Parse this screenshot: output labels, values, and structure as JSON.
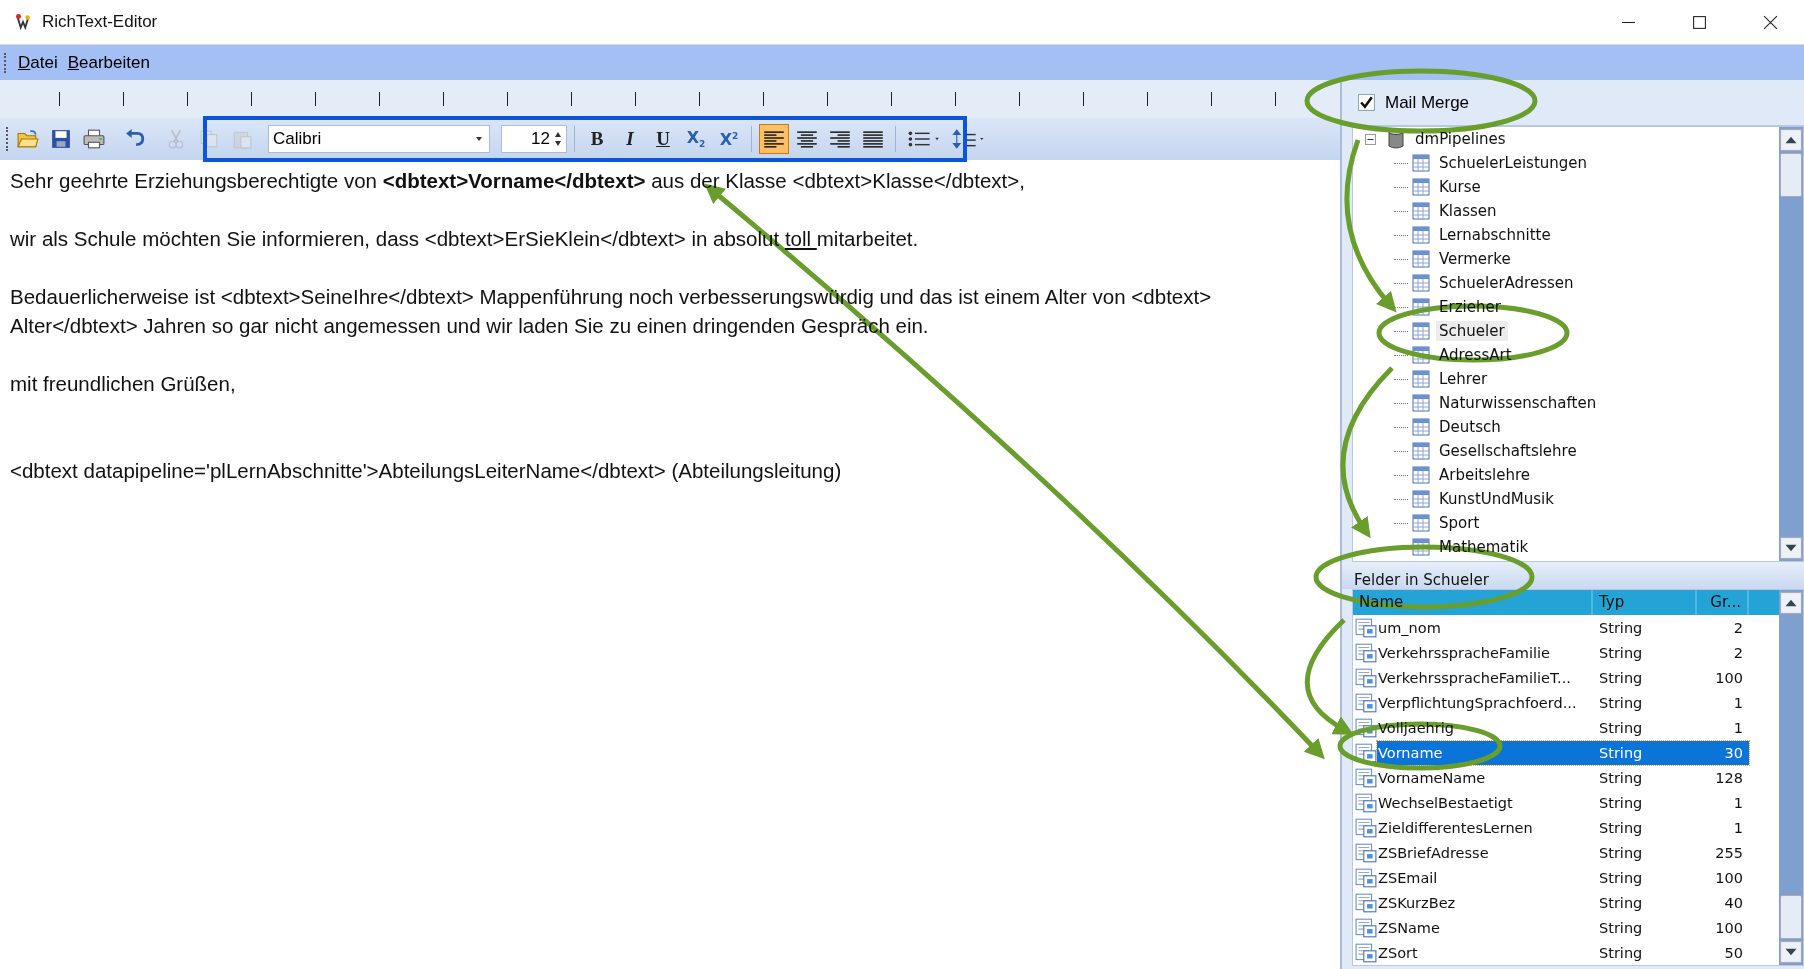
{
  "window": {
    "title": "RichText-Editor"
  },
  "menu": [
    {
      "label": "Datei"
    },
    {
      "label": "Bearbeiten"
    }
  ],
  "toolbar": {
    "file_buttons": [
      {
        "kind": "open",
        "disabled": false
      },
      {
        "kind": "save",
        "disabled": false
      },
      {
        "kind": "print",
        "disabled": false
      },
      {
        "kind": "undo",
        "disabled": false
      },
      {
        "kind": "cut",
        "disabled": true
      },
      {
        "kind": "copy",
        "disabled": true
      },
      {
        "kind": "paste",
        "disabled": true
      }
    ],
    "font_family": "Calibri",
    "font_size": "12",
    "format_buttons": [
      {
        "kind": "bold",
        "label": "B"
      },
      {
        "kind": "italic",
        "label": "I"
      },
      {
        "kind": "underline",
        "label": "U"
      },
      {
        "kind": "subscript",
        "label": "X$_{2}$"
      },
      {
        "kind": "superscript",
        "label": "X$^{2}$"
      }
    ],
    "align_buttons": [
      {
        "kind": "left",
        "selected": true
      },
      {
        "kind": "center",
        "selected": false
      },
      {
        "kind": "right",
        "selected": false
      },
      {
        "kind": "justify",
        "selected": false
      }
    ],
    "list_buttons": [
      {
        "kind": "bullets"
      },
      {
        "kind": "spacing"
      }
    ]
  },
  "document": {
    "paragraphs": [
      {
        "runs": [
          {
            "text": "Sehr geehrte Erziehungsberechtigte von **<dbtext>Vorname</dbtext>** aus der Klasse <dbtext>Klasse</dbtext>,",
            "underline": false
          }
        ]
      },
      {
        "runs": [
          {
            "text": "wir als Schule möchten Sie informieren, dass <dbtext>ErSieKlein</dbtext> in absolut ",
            "underline": false
          },
          {
            "text": "toll ",
            "underline": true
          },
          {
            "text": "mitarbeitet.",
            "underline": false
          }
        ]
      },
      {
        "runs": [
          {
            "text": "Bedauerlicherweise ist <dbtext>SeineIhre</dbtext> Mappenführung noch verbesserungswürdig und das ist einem Alter von <dbtext> Alter</dbtext> Jahren so gar nicht angemessen und wir laden Sie zu einen dringenden Gespräch ein.",
            "underline": false
          }
        ]
      },
      {
        "runs": [
          {
            "text": "mit freundlichen Grüßen,",
            "underline": false
          }
        ]
      },
      {
        "runs": [
          {
            "text": "<dbtext datapipeline='plLernAbschnitte'>AbteilungsLeiterName</dbtext> (Abteilungsleitung)",
            "underline": false
          }
        ]
      }
    ]
  },
  "mail_merge": {
    "label": "Mail Merge",
    "checked": true
  },
  "tree": {
    "label": "dmPipelines",
    "expanded": true,
    "children": [
      {
        "label": "SchuelerLeistungen",
        "selected": false
      },
      {
        "label": "Kurse",
        "selected": false
      },
      {
        "label": "Klassen",
        "selected": false
      },
      {
        "label": "Lernabschnitte",
        "selected": false
      },
      {
        "label": "Vermerke",
        "selected": false
      },
      {
        "label": "SchuelerAdressen",
        "selected": false
      },
      {
        "label": "Erzieher",
        "selected": false
      },
      {
        "label": "Schueler",
        "selected": true
      },
      {
        "label": "AdressArt",
        "selected": false
      },
      {
        "label": "Lehrer",
        "selected": false
      },
      {
        "label": "Naturwissenschaften",
        "selected": false
      },
      {
        "label": "Deutsch",
        "selected": false
      },
      {
        "label": "Gesellschaftslehre",
        "selected": false
      },
      {
        "label": "Arbeitslehre",
        "selected": false
      },
      {
        "label": "KunstUndMusik",
        "selected": false
      },
      {
        "label": "Sport",
        "selected": false
      },
      {
        "label": "Mathematik",
        "selected": false
      }
    ]
  },
  "fields": {
    "title": "Felder in Schueler",
    "columns": [
      "Name",
      "Typ",
      "Gr..."
    ],
    "rows": [
      {
        "name": "um_nom",
        "type": "String",
        "size": "2",
        "selected": false
      },
      {
        "name": "VerkehrsspracheFamilie",
        "type": "String",
        "size": "2",
        "selected": false
      },
      {
        "name": "VerkehrsspracheFamilieT...",
        "type": "String",
        "size": "100",
        "selected": false
      },
      {
        "name": "VerpflichtungSprachfoerd...",
        "type": "String",
        "size": "1",
        "selected": false
      },
      {
        "name": "Volljaehrig",
        "type": "String",
        "size": "1",
        "selected": false
      },
      {
        "name": "Vorname",
        "type": "String",
        "size": "30",
        "selected": true
      },
      {
        "name": "VornameName",
        "type": "String",
        "size": "128",
        "selected": false
      },
      {
        "name": "WechselBestaetigt",
        "type": "String",
        "size": "1",
        "selected": false
      },
      {
        "name": "ZieldifferentesLernen",
        "type": "String",
        "size": "1",
        "selected": false
      },
      {
        "name": "ZSBriefAdresse",
        "type": "String",
        "size": "255",
        "selected": false
      },
      {
        "name": "ZSEmail",
        "type": "String",
        "size": "100",
        "selected": false
      },
      {
        "name": "ZSKurzBez",
        "type": "String",
        "size": "40",
        "selected": false
      },
      {
        "name": "ZSName",
        "type": "String",
        "size": "100",
        "selected": false
      },
      {
        "name": "ZSort",
        "type": "String",
        "size": "50",
        "selected": false
      }
    ]
  }
}
